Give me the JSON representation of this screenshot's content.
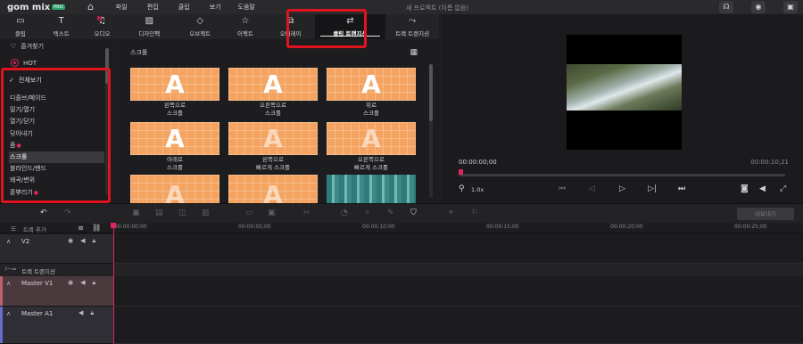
{
  "app": {
    "logo_text": "gom mix",
    "logo_badge": "PRO",
    "menu": [
      "파일",
      "편집",
      "클립",
      "보기",
      "도움말"
    ],
    "project_title": "새 프로젝트 (이름 없음)"
  },
  "tabs": [
    {
      "label": "클립",
      "icon": "clip-icon"
    },
    {
      "label": "텍스트",
      "icon": "text-icon"
    },
    {
      "label": "오디오",
      "icon": "audio-icon",
      "badge": "N"
    },
    {
      "label": "디자인팩",
      "icon": "design-pack-icon"
    },
    {
      "label": "오브젝트",
      "icon": "object-icon"
    },
    {
      "label": "이펙트",
      "icon": "effect-icon"
    },
    {
      "label": "오버레이",
      "icon": "overlay-icon"
    },
    {
      "label": "클립 트랜지션",
      "icon": "clip-transition-icon",
      "active": true
    },
    {
      "label": "트랙 트랜지션",
      "icon": "track-transition-icon"
    }
  ],
  "left_panel": {
    "favorites": "즐겨찾기",
    "hot": "HOT",
    "all_label": "전체보기",
    "categories": [
      {
        "label": "디졸브/페이드"
      },
      {
        "label": "밀기/열기"
      },
      {
        "label": "열기/닫기"
      },
      {
        "label": "닦아내기"
      },
      {
        "label": "줌",
        "new_dot": true
      },
      {
        "label": "스크롤",
        "selected": true
      },
      {
        "label": "블라인드/밴드"
      },
      {
        "label": "왜곡/변위"
      },
      {
        "label": "흩뿌리기",
        "new_dot": true
      },
      {
        "label": "회전/교대/넘김",
        "new_dot": true
      }
    ]
  },
  "thumbs_panel": {
    "header": "스크롤",
    "items": [
      {
        "line1": "왼쪽으로",
        "line2": "스크롤"
      },
      {
        "line1": "오른쪽으로",
        "line2": "스크롤"
      },
      {
        "line1": "위로",
        "line2": "스크롤"
      },
      {
        "line1": "아래로",
        "line2": "스크롤"
      },
      {
        "line1": "왼쪽으로",
        "line2": "빠르게 스크롤"
      },
      {
        "line1": "오른쪽으로",
        "line2": "빠르게 스크롤"
      }
    ]
  },
  "preview": {
    "timecode_current": "00:00:00;00",
    "timecode_total": "00:00:10;21",
    "zoom": "1.0x"
  },
  "timeline": {
    "export_label": "내보내기",
    "add_track": "트랙 추가",
    "ruler_ticks": [
      "00:00:00;00",
      "00:00:05;00",
      "00:00:10;00",
      "00:00:15;00",
      "00:00:20;00",
      "00:00:25;00"
    ],
    "tracks": {
      "v2": "V2",
      "transition": "트랙 트랜지션",
      "master_v1": "Master V1",
      "master_a1": "Master A1"
    }
  },
  "colors": {
    "accent_red": "#e0245e",
    "annotation_red": "#e0141e",
    "thumb_orange": "#f4a360"
  }
}
